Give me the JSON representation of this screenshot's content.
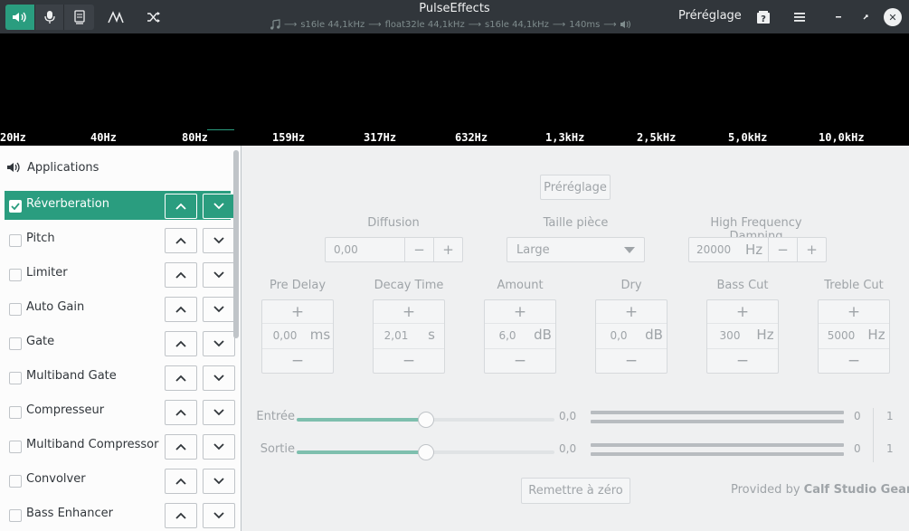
{
  "header": {
    "title": "PulseEffects",
    "pipeline": [
      "s16le 44,1kHz",
      "float32le 44,1kHz",
      "s16le 44,1kHz",
      "140ms"
    ],
    "preset_label": "Préréglage"
  },
  "spectrum": {
    "frequencies": [
      "20Hz",
      "40Hz",
      "80Hz",
      "159Hz",
      "317Hz",
      "632Hz",
      "1,3kHz",
      "2,5kHz",
      "5,0kHz",
      "10,0kHz"
    ]
  },
  "sidebar": {
    "applications_label": "Applications",
    "plugins": [
      {
        "label": "Réverberation",
        "checked": true
      },
      {
        "label": "Pitch",
        "checked": false
      },
      {
        "label": "Limiter",
        "checked": false
      },
      {
        "label": "Auto Gain",
        "checked": false
      },
      {
        "label": "Gate",
        "checked": false
      },
      {
        "label": "Multiband Gate",
        "checked": false
      },
      {
        "label": "Compresseur",
        "checked": false
      },
      {
        "label": "Multiband Compressor",
        "checked": false
      },
      {
        "label": "Convolver",
        "checked": false
      },
      {
        "label": "Bass Enhancer",
        "checked": false
      }
    ]
  },
  "main": {
    "preset_button": "Préréglage",
    "diffusion": {
      "label": "Diffusion",
      "value": "0,00"
    },
    "room_size": {
      "label": "Taille pièce",
      "value": "Large"
    },
    "hf_damping": {
      "label": "High Frequency Damping",
      "value": "20000",
      "unit": "Hz"
    },
    "params": [
      {
        "label": "Pre Delay",
        "value": "0,00",
        "unit": "ms"
      },
      {
        "label": "Decay Time",
        "value": "2,01",
        "unit": "s"
      },
      {
        "label": "Amount",
        "value": "6,0",
        "unit": "dB"
      },
      {
        "label": "Dry",
        "value": "0,0",
        "unit": "dB"
      },
      {
        "label": "Bass Cut",
        "value": "300",
        "unit": "Hz"
      },
      {
        "label": "Treble Cut",
        "value": "5000",
        "unit": "Hz"
      }
    ],
    "input": {
      "label": "Entrée",
      "value": "0,0",
      "level": 0.5,
      "meter_left": "0",
      "meter_right": "1"
    },
    "output": {
      "label": "Sortie",
      "value": "0,0",
      "level": 0.5,
      "meter_left": "0",
      "meter_right": "1"
    },
    "reset_button": "Remettre à zéro",
    "provided_by": "Provided by",
    "provider": "Calf Studio Gears"
  }
}
